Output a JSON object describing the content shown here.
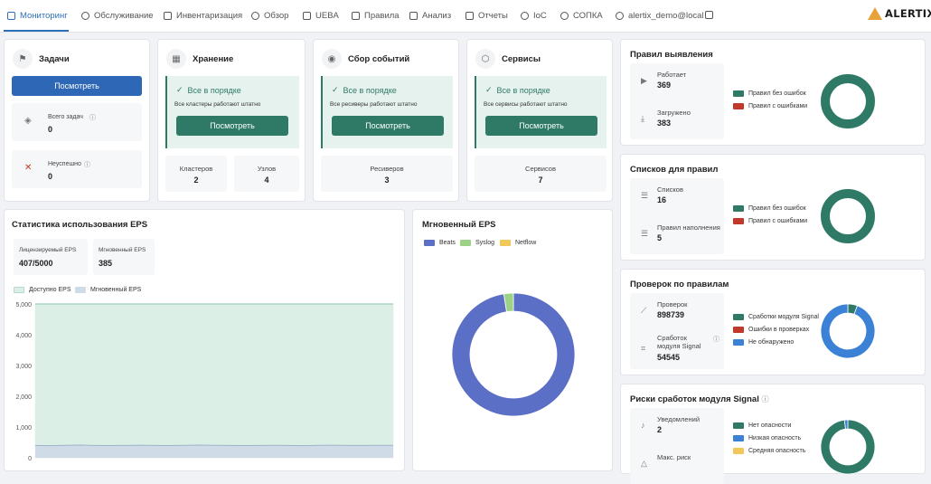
{
  "nav": {
    "items": [
      "Мониторинг",
      "Обслуживание",
      "Инвентаризация",
      "Обзор",
      "UEBA",
      "Правила",
      "Анализ",
      "Отчеты",
      "IoC",
      "СОПКА",
      "alertix_demo@local"
    ],
    "logo": "ALERTIX"
  },
  "tasks": {
    "title": "Задачи",
    "button": "Посмотреть",
    "total_label": "Всего задач",
    "total_value": "0",
    "failed_label": "Неуспешно",
    "failed_value": "0"
  },
  "storage": {
    "title": "Хранение",
    "ok": "Все в порядке",
    "ok_sub": "Все кластеры работают штатно",
    "button": "Посмотреть",
    "clusters_label": "Кластеров",
    "clusters_value": "2",
    "nodes_label": "Узлов",
    "nodes_value": "4"
  },
  "events": {
    "title": "Сбор событий",
    "ok": "Все в порядке",
    "ok_sub": "Все ресиверы работают штатно",
    "button": "Посмотреть",
    "receivers_label": "Ресиверов",
    "receivers_value": "3"
  },
  "services": {
    "title": "Сервисы",
    "ok": "Все в порядке",
    "ok_sub": "Все сервисы работают штатно",
    "button": "Посмотреть",
    "services_label": "Сервисов",
    "services_value": "7"
  },
  "eps": {
    "title": "Статистика использования EPS",
    "licensed_label": "Лицензируемый EPS",
    "licensed_value": "407/5000",
    "instant_label": "Мгновенный EPS",
    "instant_value": "385",
    "legend_available": "Доступно EPS",
    "legend_instant": "Мгновенный EPS",
    "color_available": "#dcefe7",
    "color_instant": "#cfdbe6"
  },
  "instant_eps": {
    "title": "Мгновенный EPS",
    "legend": [
      "Beats",
      "Syslog",
      "Netflow"
    ],
    "colors": [
      "#5c6fc6",
      "#9cd285",
      "#f3c85a"
    ]
  },
  "rules": {
    "title": "Правил выявления",
    "working_label": "Работает",
    "working_value": "369",
    "loaded_label": "Загружено",
    "loaded_value": "383",
    "legend": [
      "Правил без ошибок",
      "Правил с ошибками"
    ],
    "colors": [
      "#2f7a66",
      "#c0392b"
    ],
    "values": [
      383,
      0
    ]
  },
  "lists": {
    "title": "Списков для правил",
    "lists_label": "Списков",
    "lists_value": "16",
    "fill_label": "Правил наполнения",
    "fill_value": "5",
    "legend": [
      "Правил без ошибок",
      "Правил с ошибками"
    ],
    "colors": [
      "#2f7a66",
      "#c0392b"
    ],
    "values": [
      21,
      0
    ]
  },
  "checks": {
    "title": "Проверок по правилам",
    "checks_label": "Проверок",
    "checks_value": "898739",
    "signal_label": "Сработок модуля Signal",
    "signal_value": "54545",
    "legend": [
      "Сработки модуля Signal",
      "Ошибки в проверках",
      "Не обнаружено"
    ],
    "colors": [
      "#2f7a66",
      "#c0392b",
      "#3b82d6"
    ],
    "values": [
      5.7,
      0,
      94.3
    ]
  },
  "risks": {
    "title": "Риски сработок модуля Signal",
    "notif_label": "Уведомлений",
    "notif_value": "2",
    "max_label": "Макс. риск",
    "legend": [
      "Нет опасности",
      "Низкая опасность",
      "Средняя опасность"
    ],
    "colors": [
      "#2f7a66",
      "#3b82d6",
      "#f3c85a"
    ]
  },
  "chart_data": [
    {
      "type": "area",
      "title": "Статистика использования EPS",
      "ylim": [
        0,
        5000
      ],
      "yticks": [
        "5,000",
        "4,000",
        "3,000",
        "2,000",
        "1,000",
        "0"
      ],
      "series": [
        {
          "name": "Доступно EPS",
          "values": [
            5000,
            5000,
            5000,
            5000,
            5000,
            5000,
            5000,
            5000,
            5000,
            5000,
            5000,
            5000,
            5000,
            5000,
            5000,
            5000,
            5000,
            5000,
            5000,
            5000,
            5000,
            5000,
            5000,
            5000,
            5000
          ]
        },
        {
          "name": "Мгновенный EPS",
          "values": [
            400,
            395,
            405,
            410,
            400,
            398,
            402,
            408,
            400,
            396,
            404,
            410,
            405,
            400,
            398,
            402,
            406,
            400,
            395,
            403,
            407,
            401,
            399,
            404,
            405
          ]
        }
      ]
    },
    {
      "type": "pie",
      "title": "Мгновенный EPS",
      "labels": [
        "Beats",
        "Syslog",
        "Netflow"
      ],
      "values": [
        97.5,
        2.5,
        0
      ]
    }
  ]
}
